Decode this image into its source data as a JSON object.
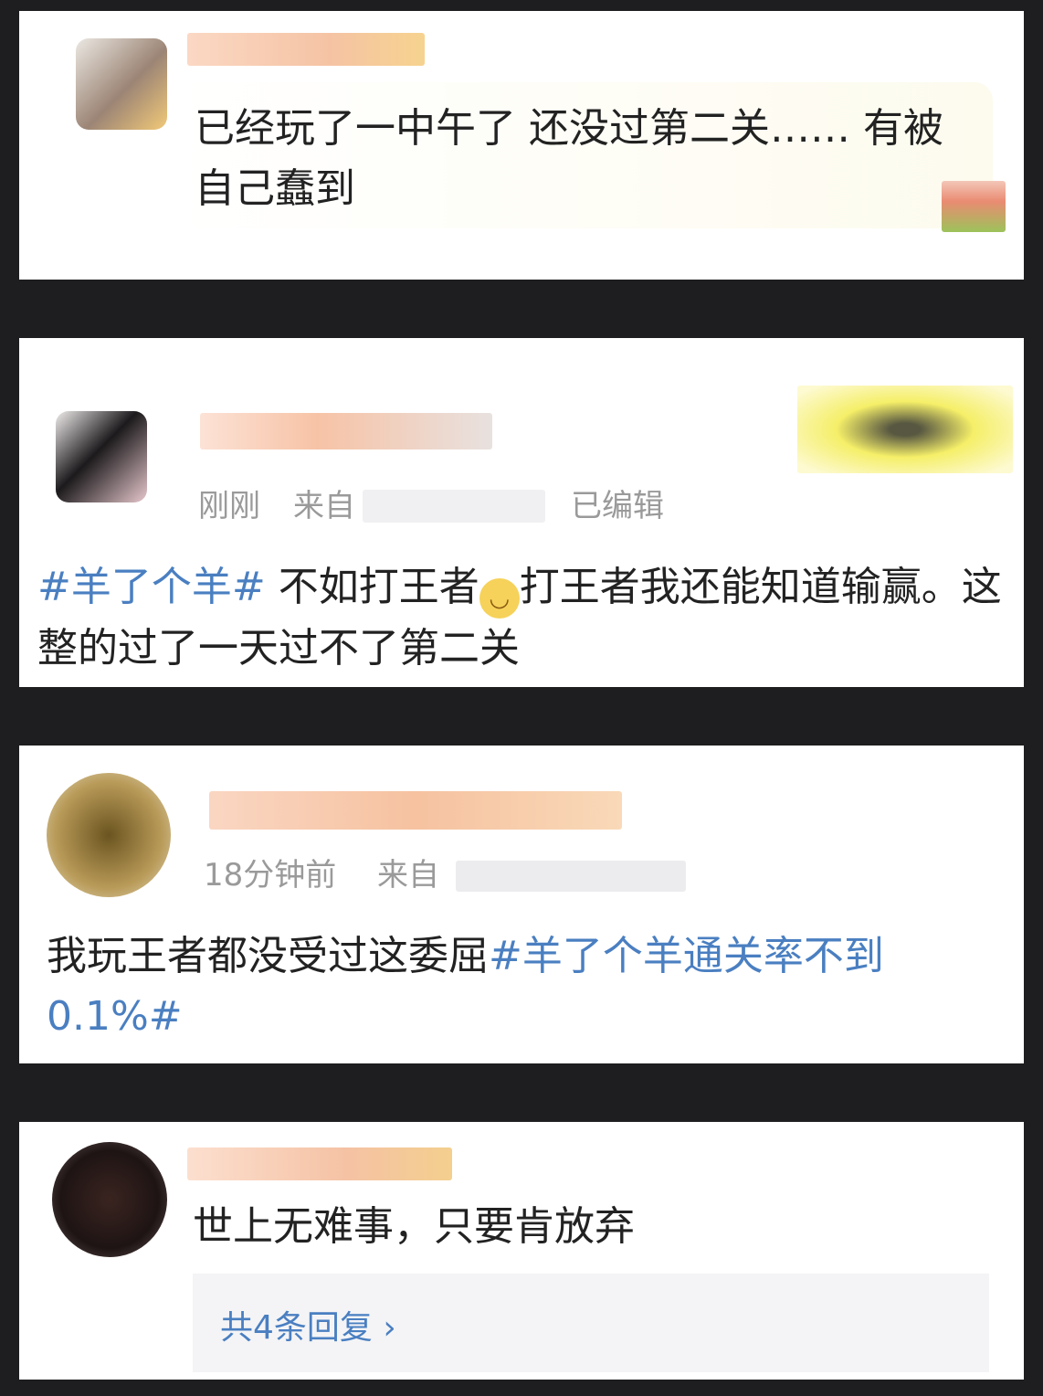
{
  "comments": [
    {
      "text": "已经玩了一中午了 还没过第二关…… 有被自己蠢到"
    },
    {
      "time": "刚刚",
      "source_prefix": "来自",
      "edited": "已编辑",
      "tag": "#羊了个羊#",
      "text_a": " 不如打王者",
      "emoji": "smirk-emoji",
      "text_b": "打王者我还能知道输赢。这整的过了一天过不了第二关"
    },
    {
      "time": "18分钟前",
      "source_prefix": "来自",
      "text": "我玩王者都没受过这委屈",
      "tag": "#羊了个羊通关率不到0.1%#"
    },
    {
      "text": "世上无难事，只要肯放弃",
      "replies_label": "共4条回复 ›"
    }
  ]
}
